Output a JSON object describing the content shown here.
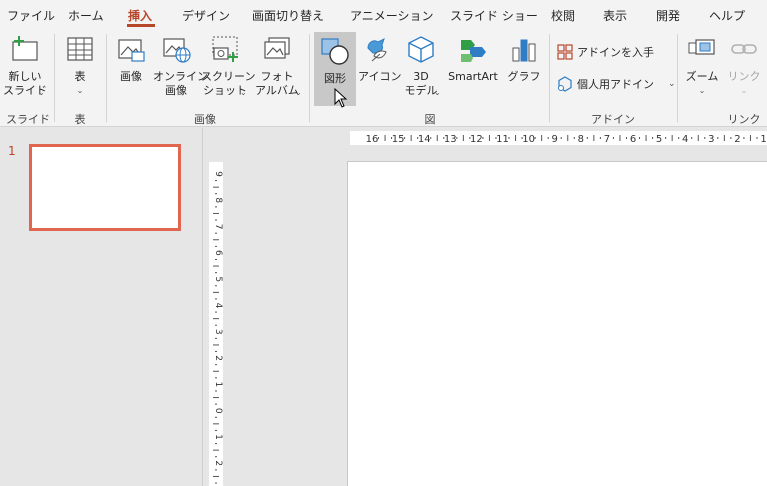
{
  "tabs": [
    {
      "label": "ファイル",
      "active": false
    },
    {
      "label": "ホーム",
      "active": false
    },
    {
      "label": "挿入",
      "active": true
    },
    {
      "label": "デザイン",
      "active": false
    },
    {
      "label": "画面切り替え",
      "active": false
    },
    {
      "label": "アニメーション",
      "active": false
    },
    {
      "label": "スライド ショー",
      "active": false
    },
    {
      "label": "校閲",
      "active": false
    },
    {
      "label": "表示",
      "active": false
    },
    {
      "label": "開発",
      "active": false
    },
    {
      "label": "ヘルプ",
      "active": false
    }
  ],
  "ribbon": {
    "new_slide": {
      "line1": "新しい",
      "line2": "スライド"
    },
    "table": {
      "label": "表"
    },
    "image": {
      "label": "画像"
    },
    "online_image": {
      "line1": "オンライン",
      "line2": "画像"
    },
    "screenshot": {
      "line1": "スクリーン",
      "line2": "ショット"
    },
    "photo_album": {
      "line1": "フォト",
      "line2": "アルバム"
    },
    "shapes": {
      "label": "図形"
    },
    "icons": {
      "label": "アイコン"
    },
    "model3d": {
      "line1": "3D",
      "line2": "モデル"
    },
    "smartart": {
      "label": "SmartArt"
    },
    "chart": {
      "label": "グラフ"
    },
    "get_addins": {
      "label": "アドインを入手"
    },
    "my_addins": {
      "label": "個人用アドイン"
    },
    "zoom": {
      "label": "ズーム"
    },
    "link": {
      "label": "リンク"
    },
    "groups": {
      "slides": "スライド",
      "table": "表",
      "images": "画像",
      "illustrations": "図",
      "addins": "アドイン",
      "links": "リンク"
    }
  },
  "thumbnails": {
    "slide_number": "1"
  },
  "ruler": {
    "horizontal_labels": [
      "16",
      "15",
      "14",
      "13",
      "12",
      "11",
      "10",
      "9",
      "8",
      "7",
      "6",
      "5",
      "4",
      "3",
      "2",
      "1"
    ],
    "vertical_labels": [
      "9",
      "8",
      "7",
      "6",
      "5",
      "4",
      "3",
      "2",
      "1",
      "0",
      "1",
      "2"
    ]
  },
  "colors": {
    "accent": "#b7472a",
    "thumb_border": "#e0664f",
    "icon_blue": "#2f7dc4"
  }
}
